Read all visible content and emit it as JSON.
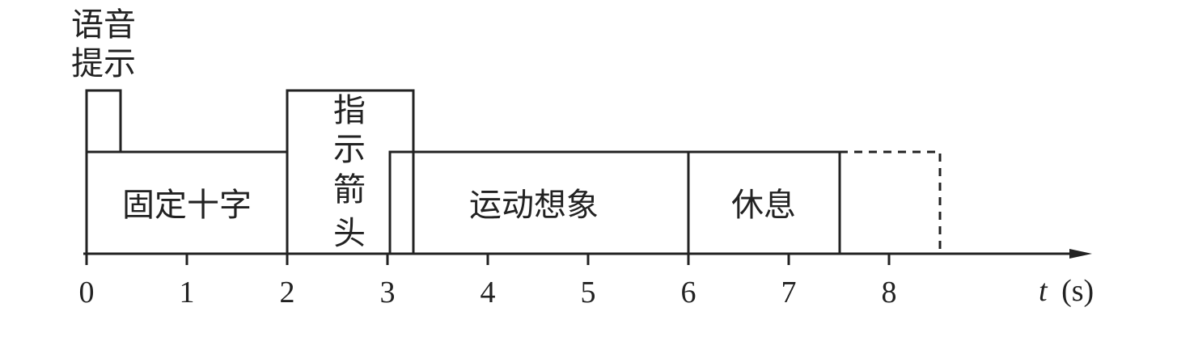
{
  "diagram": {
    "axis": {
      "ticks": [
        "0",
        "1",
        "2",
        "3",
        "4",
        "5",
        "6",
        "7",
        "8"
      ],
      "unit_var": "t",
      "unit": "(s)"
    },
    "phases": {
      "voice_prompt": {
        "label_lines": [
          "语音",
          "提示"
        ],
        "start": 0,
        "end": 0.35
      },
      "fixation_cross": {
        "label": "固定十字",
        "start": 0,
        "end": 2
      },
      "indicator_arrow": {
        "label_chars": [
          "指",
          "示",
          "箭",
          "头"
        ],
        "start": 2,
        "end": 3.25
      },
      "motor_imagery": {
        "label": "运动想象",
        "start": 3,
        "end": 6
      },
      "rest": {
        "label": "休息",
        "start": 6,
        "end": 7.5
      },
      "next_trial": {
        "start": 7.5,
        "end": 8.5,
        "style": "dashed"
      }
    },
    "colors": {
      "stroke": "#222222",
      "background": "#ffffff"
    }
  }
}
